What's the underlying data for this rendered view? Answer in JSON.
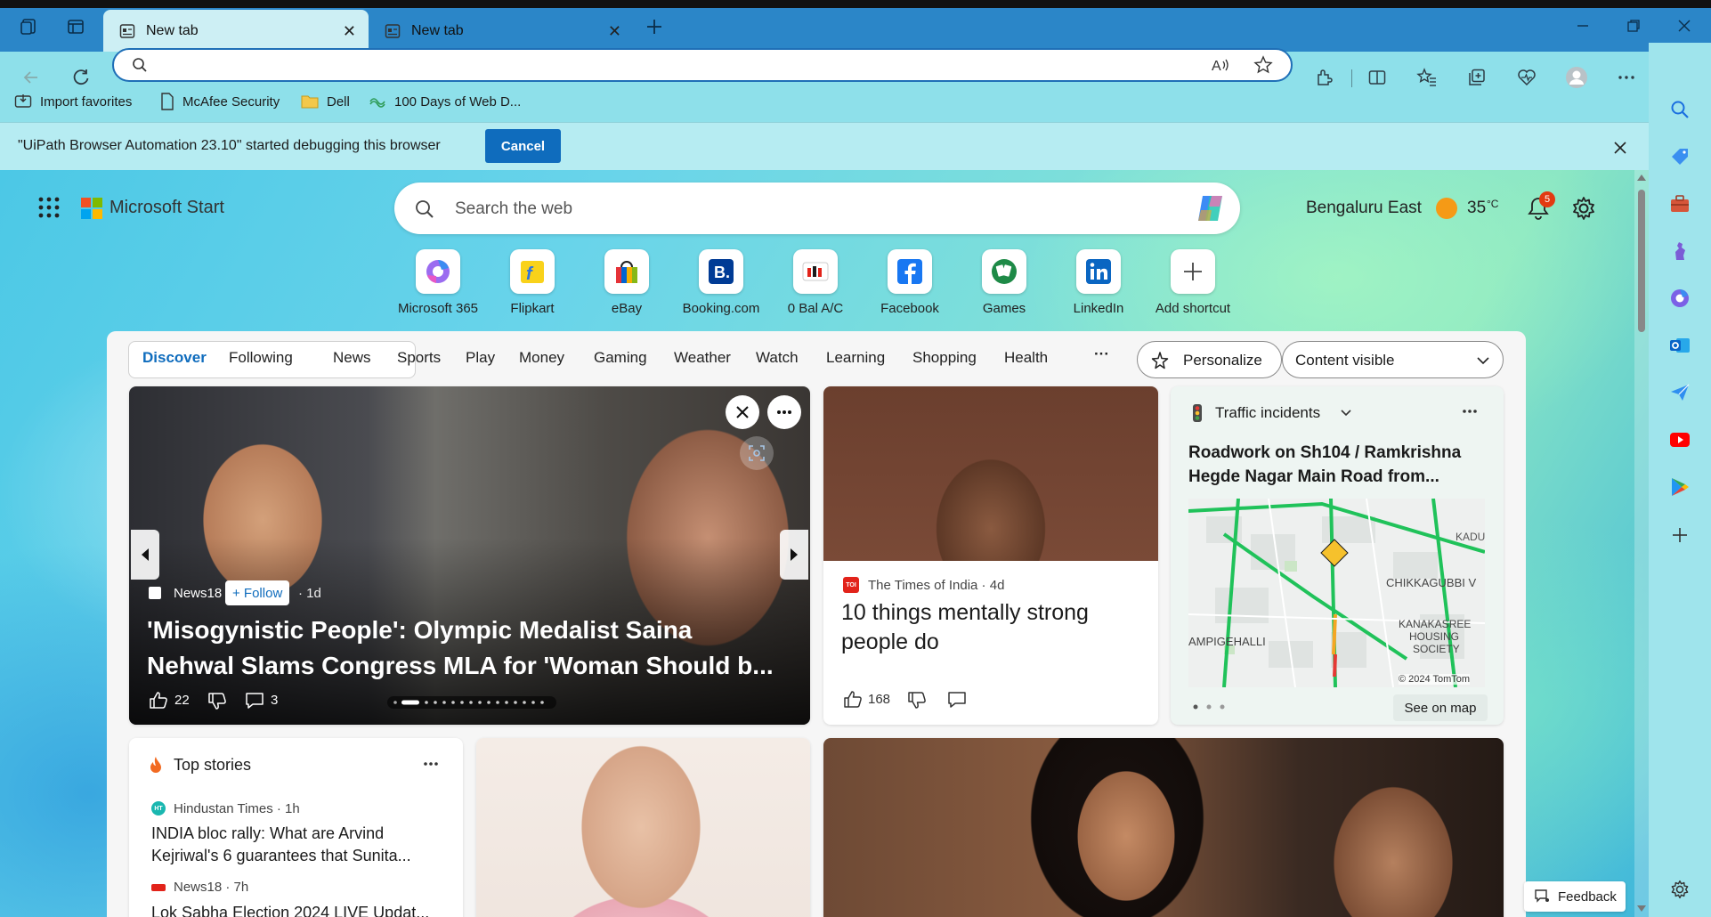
{
  "browser": {
    "tabs": [
      {
        "title": "New tab",
        "active": true
      },
      {
        "title": "New tab",
        "active": false
      }
    ],
    "address_value": "",
    "bookmarks": [
      "Import favorites",
      "McAfee Security",
      "Dell",
      "100 Days of Web D..."
    ],
    "info_bar": {
      "message": "\"UiPath Browser Automation 23.10\" started debugging this browser",
      "cancel_label": "Cancel"
    }
  },
  "page": {
    "brand": "Microsoft Start",
    "search_placeholder": "Search the web",
    "weather": {
      "location": "Bengaluru East",
      "temp": "35",
      "unit": "°C"
    },
    "notification_count": "5",
    "shortcuts": [
      "Microsoft 365",
      "Flipkart",
      "eBay",
      "Booking.com",
      "0 Bal A/C",
      "Facebook",
      "Games",
      "LinkedIn",
      "Add shortcut"
    ],
    "nav": {
      "discover": "Discover",
      "following": "Following",
      "items": [
        "News",
        "Sports",
        "Play",
        "Money",
        "Gaming",
        "Weather",
        "Watch",
        "Learning",
        "Shopping",
        "Health"
      ],
      "more": "···",
      "personalize": "Personalize",
      "content_select": "Content visible"
    },
    "hero": {
      "source": "News18",
      "follow_label": "+ Follow",
      "age": "· 1d",
      "headline_line1": "'Misogynistic People': Olympic Medalist Saina",
      "headline_line2": "Nehwal Slams Congress MLA for 'Woman Should b...",
      "likes": "22",
      "comments": "3"
    },
    "toi_card": {
      "source": "The Times of India · 4d",
      "headline_line1": "10 things mentally strong",
      "headline_line2": "people do",
      "likes": "168"
    },
    "traffic": {
      "title": "Traffic incidents",
      "headline_line1": "Roadwork on Sh104 / Ramkrishna",
      "headline_line2": "Hegde Nagar Main Road from...",
      "map_labels": [
        "KADU",
        "CHIKKAGUBBI V",
        "KANAKASREE",
        "HOUSING",
        "SOCIETY",
        "AMPIGEHALLI"
      ],
      "copyright": "© 2024 TomTom",
      "see_on_map": "See on map"
    },
    "top_stories": {
      "title": "Top stories",
      "items": [
        {
          "source": "Hindustan Times · 1h",
          "line1": "INDIA bloc rally: What are Arvind",
          "line2": "Kejriwal's 6 guarantees that Sunita..."
        },
        {
          "source": "News18 · 7h",
          "line1": "Lok Sabha Election 2024 LIVE Updat...",
          "line2": ""
        }
      ]
    },
    "feedback_label": "Feedback"
  },
  "colors": {
    "accent": "#0f6cbd",
    "tab_bar": "#2b86c8",
    "toolbar": "#8ee0ea",
    "info_bar": "#b6ecf2",
    "notification_badge": "#e23a12"
  }
}
